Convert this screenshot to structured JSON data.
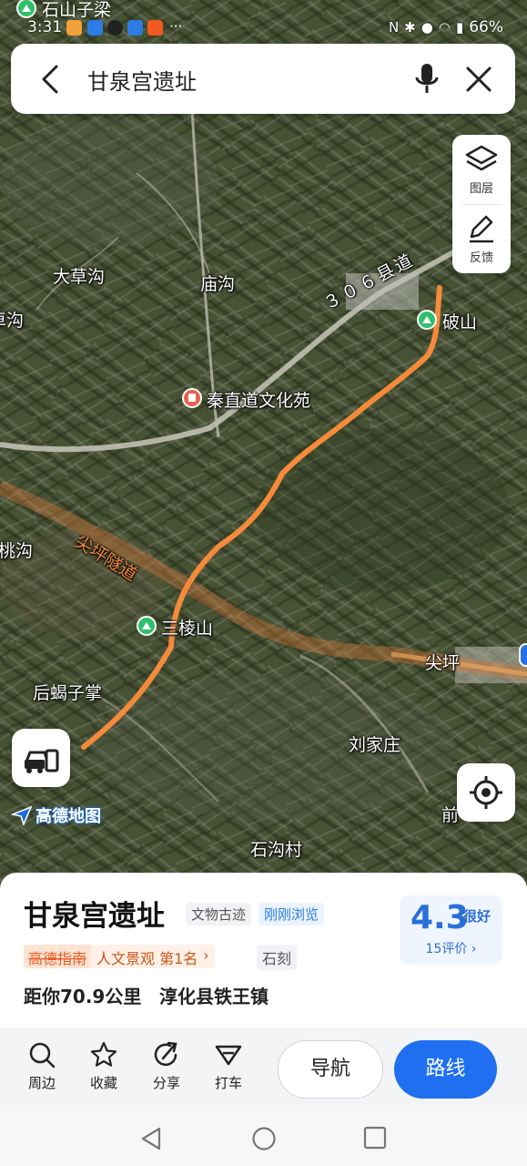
{
  "status_bar": {
    "time": "3:31",
    "location_label": "石山子梁",
    "battery": "66%"
  },
  "search": {
    "query": "甘泉宫遗址"
  },
  "tools": {
    "layers_label": "图层",
    "feedback_label": "反馈"
  },
  "map": {
    "logo_text": "高德地图",
    "labels": {
      "dacaogou": "大草沟",
      "miaogou": "庙沟",
      "edge_gou_left": "卓沟",
      "county_road": "３０６县道",
      "poshan": "破山",
      "qinzhidao": "秦直道文化苑",
      "taogou": "桃沟",
      "tunnel": "尖坪隧道",
      "sanlingshan": "三棱山",
      "houxiezizhang": "后蝎子掌",
      "jianping": "尖坪",
      "liujiazhuang": "刘家庄",
      "qian": "前",
      "shigoucun": "石沟村"
    },
    "colors": {
      "route": "#f58a3b",
      "tunnel_road": "#e07a3a"
    }
  },
  "place": {
    "name": "甘泉宫遗址",
    "category_tag": "文物古迹",
    "viewed_tag": "刚刚浏览",
    "rank_brand": "高德指南",
    "rank_text": "人文景观 第1名",
    "stone_tag": "石刻",
    "distance": "距你70.9公里",
    "address": "淳化县铁王镇",
    "rating": {
      "score": "4.3",
      "word": "很好",
      "count": "15评价"
    }
  },
  "actions": {
    "nearby": "周边",
    "favorite": "收藏",
    "share": "分享",
    "taxi": "打车",
    "navigate": "导航",
    "route": "路线"
  }
}
